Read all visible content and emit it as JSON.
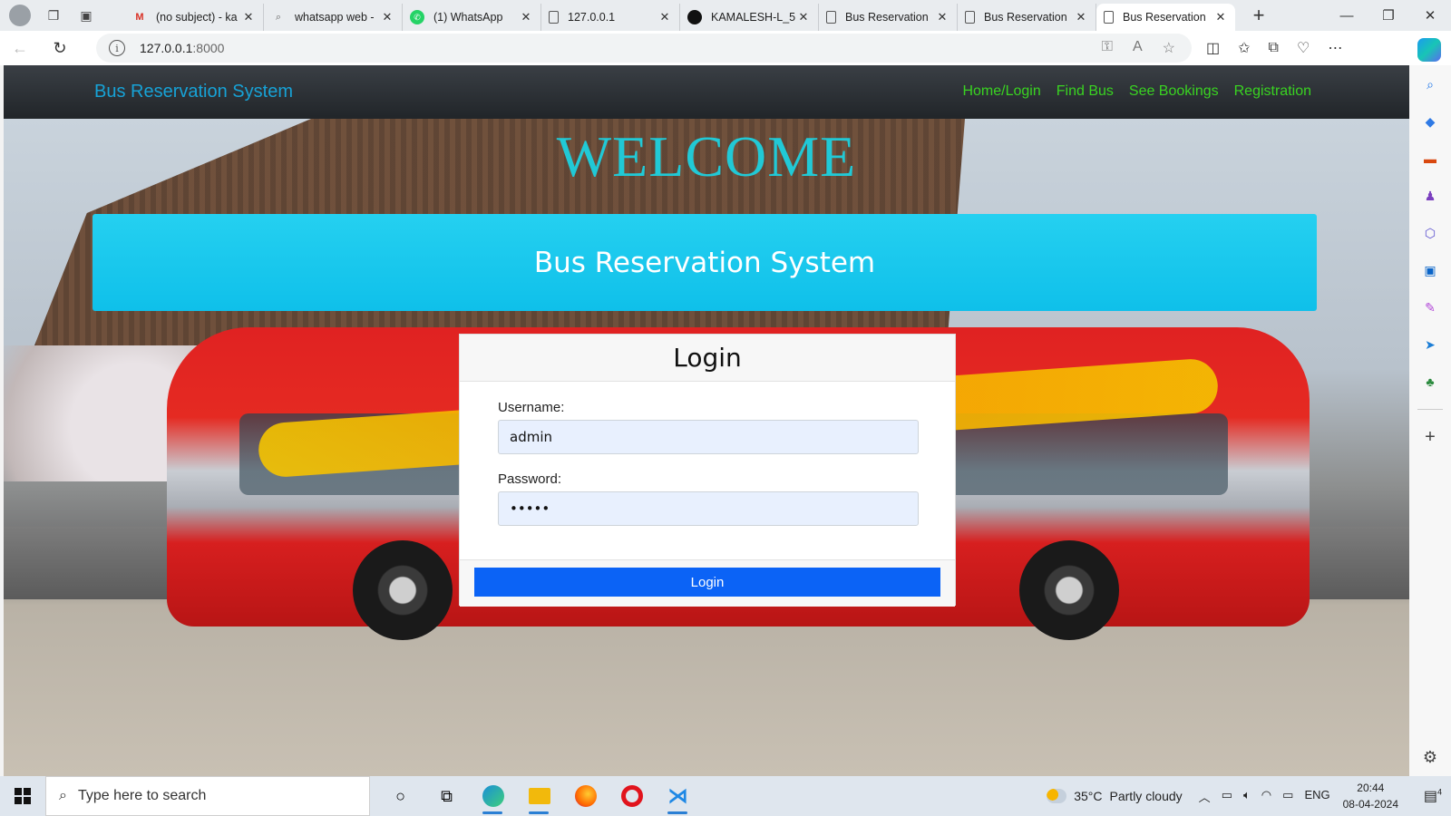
{
  "browser": {
    "tabs": [
      {
        "title": "(no subject) - ka",
        "icon": "gmail-icon"
      },
      {
        "title": "whatsapp web -",
        "icon": "search-icon"
      },
      {
        "title": "(1) WhatsApp",
        "icon": "whatsapp-icon"
      },
      {
        "title": "127.0.0.1",
        "icon": "page-icon"
      },
      {
        "title": "KAMALESH-L_5",
        "icon": "github-icon"
      },
      {
        "title": "Bus Reservation",
        "icon": "page-icon"
      },
      {
        "title": "Bus Reservation",
        "icon": "page-icon"
      },
      {
        "title": "Bus Reservation",
        "icon": "page-icon",
        "active": true
      }
    ],
    "url_host": "127.0.0.1",
    "url_port": ":8000"
  },
  "site": {
    "brand": "Bus Reservation System",
    "nav": [
      "Home/Login",
      "Find Bus",
      "See Bookings",
      "Registration"
    ],
    "welcome": "WELCOME",
    "jumbotron_title": "Bus Reservation System",
    "login": {
      "header": "Login",
      "username_label": "Username:",
      "username_value": "admin",
      "password_label": "Password:",
      "password_value": "admin",
      "button": "Login"
    }
  },
  "taskbar": {
    "search_placeholder": "Type here to search",
    "weather_temp": "35°C",
    "weather_desc": "Partly cloudy",
    "language": "ENG",
    "time": "20:44",
    "date": "08-04-2024",
    "notification_count": "4"
  },
  "colors": {
    "brand_link": "#17a2d6",
    "nav_link": "#39d321",
    "jumbotron": "#1ec6ee",
    "login_button": "#0b63f6",
    "welcome_text": "#21c9d6"
  }
}
